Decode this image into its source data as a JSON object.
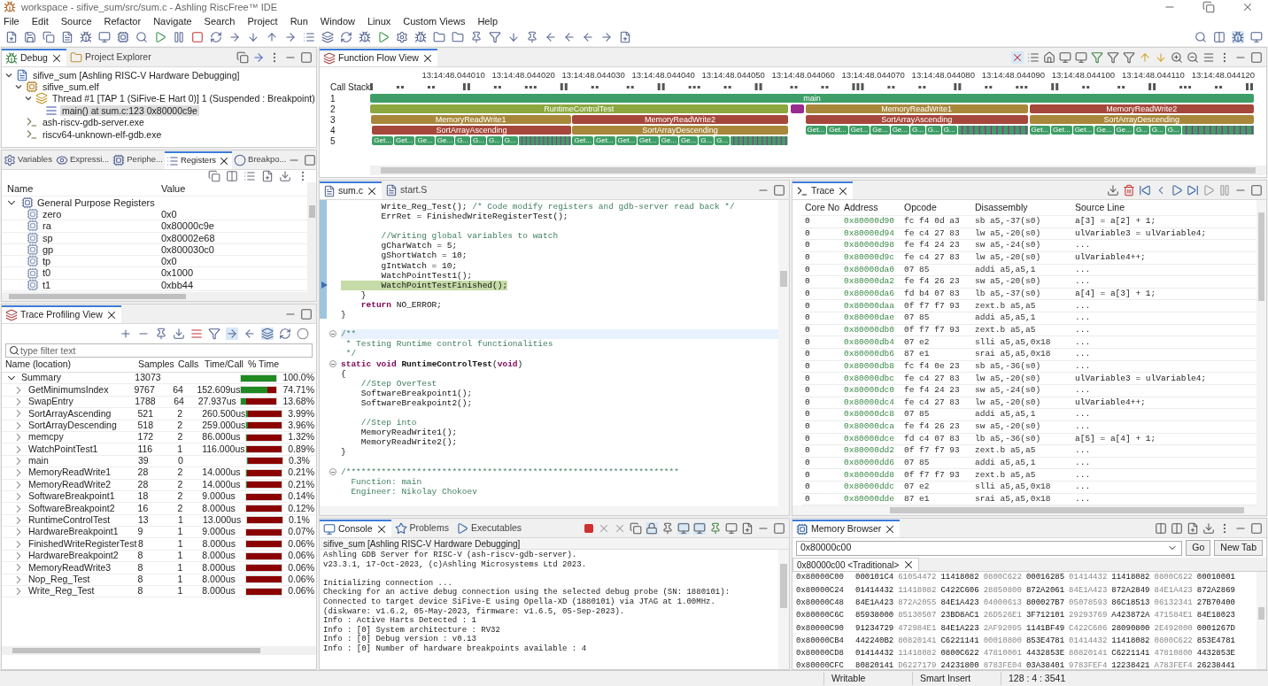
{
  "window": {
    "title": "workspace - sifive_sum/src/sum.c - Ashling RiscFree™ IDE"
  },
  "menu": [
    "File",
    "Edit",
    "Source",
    "Refactor",
    "Navigate",
    "Search",
    "Project",
    "Run",
    "Window",
    "Linux",
    "Custom Views",
    "Help"
  ],
  "debug_panel": {
    "tabs": [
      {
        "label": "Debug",
        "selected": true
      },
      {
        "label": "Project Explorer",
        "selected": false
      }
    ],
    "tree": [
      {
        "label": "sifive_sum [Ashling RISC-V Hardware Debugging]",
        "kind": "launch",
        "expanded": true,
        "selected": false,
        "children": [
          {
            "label": "sifive_sum.elf",
            "kind": "process",
            "expanded": true,
            "selected": false,
            "children": [
              {
                "label": "Thread #1 [TAP 1 (SiFive-E Hart 0)] 1 (Suspended : Breakpoint)",
                "kind": "thread",
                "expanded": true,
                "selected": false,
                "children": [
                  {
                    "label": "main() at sum.c:123 0x80000c9e",
                    "kind": "frame",
                    "selected": true
                  }
                ]
              }
            ]
          },
          {
            "label": "ash-riscv-gdb-server.exe",
            "kind": "exe",
            "selected": false
          },
          {
            "label": "riscv64-unknown-elf-gdb.exe",
            "kind": "exe",
            "selected": false
          }
        ]
      }
    ]
  },
  "registers_panel": {
    "tabs": [
      {
        "label": "Variables",
        "selected": false
      },
      {
        "label": "Expressi...",
        "selected": false
      },
      {
        "label": "Periphe...",
        "selected": false
      },
      {
        "label": "Registers",
        "selected": true
      },
      {
        "label": "Breakpo...",
        "selected": false
      }
    ],
    "columns": [
      "Name",
      "Value"
    ],
    "group": "General Purpose Registers",
    "rows": [
      {
        "name": "zero",
        "value": "0x0"
      },
      {
        "name": "ra",
        "value": "0x80000c9e"
      },
      {
        "name": "sp",
        "value": "0x80002e68"
      },
      {
        "name": "gp",
        "value": "0x800030c0"
      },
      {
        "name": "tp",
        "value": "0x0"
      },
      {
        "name": "t0",
        "value": "0x1000"
      },
      {
        "name": "t1",
        "value": "0xbb44"
      }
    ]
  },
  "profiling": {
    "title": "Trace Profiling View",
    "filter": {
      "placeholder": "type filter text"
    },
    "columns": [
      "Name (location)",
      "Samples",
      "Calls",
      "Time/Call",
      "% Time"
    ],
    "summary": {
      "name": "Summary",
      "samples": "13073",
      "level": 1,
      "percent": "100.0%"
    },
    "rows": [
      {
        "name": "GetMinimumsIndex",
        "samples": "9767",
        "calls": "64",
        "time_per_call": "152.609us",
        "level": 0.7471,
        "percent": "74.71%"
      },
      {
        "name": "SwapEntry",
        "samples": "1788",
        "calls": "64",
        "time_per_call": "27.937us",
        "level": 0.1368,
        "percent": "13.68%"
      },
      {
        "name": "SortArrayAscending",
        "samples": "521",
        "calls": "2",
        "time_per_call": "260.500us",
        "level": 0.0399,
        "percent": "3.99%"
      },
      {
        "name": "SortArrayDescending",
        "samples": "518",
        "calls": "2",
        "time_per_call": "259.000us",
        "level": 0.0396,
        "percent": "3.96%"
      },
      {
        "name": "memcpy",
        "samples": "172",
        "calls": "2",
        "time_per_call": "86.000us",
        "level": 0.0132,
        "percent": "1.32%"
      },
      {
        "name": "WatchPointTest1",
        "samples": "116",
        "calls": "1",
        "time_per_call": "116.000us",
        "level": 0.0089,
        "percent": "0.89%"
      },
      {
        "name": "main",
        "samples": "39",
        "calls": "0",
        "level": 0.003,
        "percent": "0.3%"
      },
      {
        "name": "MemoryReadWrite1",
        "samples": "28",
        "calls": "2",
        "time_per_call": "14.000us",
        "level": 0.0021,
        "percent": "0.21%"
      },
      {
        "name": "MemoryReadWrite2",
        "samples": "28",
        "calls": "2",
        "time_per_call": "14.000us",
        "level": 0.0021,
        "percent": "0.21%"
      },
      {
        "name": "SoftwareBreakpoint1",
        "samples": "18",
        "calls": "2",
        "time_per_call": "9.000us",
        "level": 0.0014,
        "percent": "0.14%"
      },
      {
        "name": "SoftwareBreakpoint2",
        "samples": "16",
        "calls": "2",
        "time_per_call": "8.000us",
        "level": 0.0012,
        "percent": "0.12%"
      },
      {
        "name": "RuntimeControlTest",
        "samples": "13",
        "calls": "1",
        "time_per_call": "13.000us",
        "level": 0.001,
        "percent": "0.1%"
      },
      {
        "name": "HardwareBreakpoint1",
        "samples": "9",
        "calls": "1",
        "time_per_call": "9.000us",
        "level": 0.0007,
        "percent": "0.07%"
      },
      {
        "name": "FinishedWriteRegisterTest",
        "samples": "8",
        "calls": "1",
        "time_per_call": "8.000us",
        "level": 0.0006,
        "percent": "0.06%"
      },
      {
        "name": "HardwareBreakpoint2",
        "samples": "8",
        "calls": "1",
        "time_per_call": "8.000us",
        "level": 0.0006,
        "percent": "0.06%"
      },
      {
        "name": "MemoryReadWrite3",
        "samples": "8",
        "calls": "1",
        "time_per_call": "8.000us",
        "level": 0.0006,
        "percent": "0.06%"
      },
      {
        "name": "Nop_Reg_Test",
        "samples": "8",
        "calls": "1",
        "time_per_call": "8.000us",
        "level": 0.0006,
        "percent": "0.06%"
      },
      {
        "name": "Write_Reg_Test",
        "samples": "8",
        "calls": "1",
        "time_per_call": "8.000us",
        "level": 0.0006,
        "percent": "0.06%"
      }
    ]
  },
  "flow_view": {
    "title": "Function Flow View",
    "ticks": [
      "13:14:48.044010",
      "13:14:48.044020",
      "13:14:48.044030",
      "13:14:48.044040",
      "13:14:48.044050",
      "13:14:48.044060",
      "13:14:48.044070",
      "13:14:48.044080",
      "13:14:48.044090",
      "13:14:48.044100",
      "13:14:48.044110",
      "13:14:48.044120"
    ],
    "callstack_label": "Call Stack",
    "rows": [
      {
        "depth": "1",
        "segments": [
          {
            "kind": "function",
            "label": "main",
            "color": "#3f9e67"
          }
        ]
      },
      {
        "depth": "2",
        "segments": [
          {
            "kind": "function",
            "label": "RuntimeControlTest",
            "color": "#8ba73d"
          },
          {
            "kind": "mark",
            "color": "#9b2a8e"
          },
          {
            "kind": "function",
            "label": "MemoryReadWrite1",
            "color": "#a8873a"
          },
          {
            "kind": "function",
            "label": "MemoryReadWrite2",
            "color": "#a5473a"
          }
        ]
      },
      {
        "depth": "3",
        "segments": [
          {
            "kind": "function",
            "label": "MemoryReadWrite1",
            "color": "#a8873a"
          },
          {
            "kind": "function",
            "label": "MemoryReadWrite2",
            "color": "#a5473a"
          },
          {
            "kind": "function",
            "label": "SortArrayAscending",
            "color": "#a5473a"
          },
          {
            "kind": "function",
            "label": "SortArrayDescending",
            "color": "#a8873a"
          }
        ]
      },
      {
        "depth": "4",
        "segments": [
          {
            "kind": "function",
            "label": "SortArrayAscending",
            "color": "#a5473a"
          },
          {
            "kind": "function",
            "label": "SortArrayDescending",
            "color": "#a8873a"
          },
          {
            "kind": "calls",
            "labels": [
              "Get...",
              "Get...",
              "Get...",
              "Ge...",
              "Ge...",
              "G...",
              "G...",
              "G..."
            ],
            "color": "#3f9e67"
          },
          {
            "kind": "calls",
            "labels": [
              "Get...",
              "Get...",
              "Get...",
              "Ge...",
              "Ge...",
              "G...",
              "G...",
              "G..."
            ],
            "color": "#3f9e67"
          }
        ]
      },
      {
        "depth": "5",
        "segments": [
          {
            "kind": "calls",
            "labels": [
              "Get...",
              "Get...",
              "Ge...",
              "Ge...",
              "G...",
              "G...",
              "G...",
              "G..."
            ],
            "color": "#3f9e67"
          },
          {
            "kind": "calls",
            "labels": [
              "Get...",
              "Get...",
              "Get...",
              "Get...",
              "Ge...",
              "Ge...",
              "G...",
              "G..."
            ],
            "color": "#3f9e67"
          }
        ]
      }
    ]
  },
  "editor": {
    "tabs": [
      {
        "label": "sum.c",
        "selected": true
      },
      {
        "label": "start.S",
        "selected": false
      }
    ],
    "blocks": [
      [
        {
          "segments": [
            {
              "kind": "code",
              "text": "        Write_Reg_Test(); "
            },
            {
              "kind": "comment",
              "text": "/* Code modify registers and gdb-server read back */"
            }
          ]
        },
        {
          "segments": [
            {
              "kind": "code",
              "text": "        ErrRet = FinishedWriteRegisterTest();"
            }
          ]
        }
      ],
      [
        {
          "segments": [
            {
              "kind": "comment",
              "text": "        //Writing global variables to watch"
            }
          ]
        },
        {
          "segments": [
            {
              "kind": "code",
              "text": "        gCharWatch = 5;"
            }
          ]
        },
        {
          "segments": [
            {
              "kind": "code",
              "text": "        gShortWatch = 10;"
            }
          ]
        },
        {
          "segments": [
            {
              "kind": "code",
              "text": "        gIntWatch = 10;"
            }
          ]
        },
        {
          "segments": [
            {
              "kind": "code",
              "text": "        WatchPointTest1();"
            }
          ]
        },
        {
          "current": true,
          "segments": [
            {
              "kind": "code",
              "text": "        WatchPointTestFinished();"
            }
          ]
        },
        {
          "segments": [
            {
              "kind": "code",
              "text": "    }"
            }
          ]
        },
        {
          "segments": [
            {
              "kind": "keyword",
              "text": "    return"
            },
            {
              "kind": "code",
              "text": " NO_ERROR;"
            }
          ]
        },
        {
          "segments": [
            {
              "kind": "code",
              "text": "}"
            }
          ]
        }
      ],
      [
        {
          "fold": true,
          "hover": true,
          "segments": [
            {
              "kind": "comment",
              "text": "/**"
            }
          ]
        },
        {
          "segments": [
            {
              "kind": "comment",
              "text": " * Testing Runtime control functionalities"
            }
          ]
        },
        {
          "segments": [
            {
              "kind": "comment",
              "text": " */"
            }
          ]
        },
        {
          "fold": true,
          "segments": [
            {
              "kind": "keyword",
              "text": "static void "
            },
            {
              "kind": "name",
              "text": "RuntimeControlTest"
            },
            {
              "kind": "code",
              "text": "("
            },
            {
              "kind": "keyword",
              "text": "void"
            },
            {
              "kind": "code",
              "text": ")"
            }
          ]
        },
        {
          "segments": [
            {
              "kind": "code",
              "text": "{"
            }
          ]
        },
        {
          "segments": [
            {
              "kind": "comment",
              "text": "    //Step OverTest"
            }
          ]
        },
        {
          "segments": [
            {
              "kind": "code",
              "text": "    SoftwareBreakpoint1();"
            }
          ]
        },
        {
          "segments": [
            {
              "kind": "code",
              "text": "    SoftwareBreakpoint2();"
            }
          ]
        }
      ],
      [
        {
          "segments": [
            {
              "kind": "comment",
              "text": "    //Step into"
            }
          ]
        },
        {
          "segments": [
            {
              "kind": "code",
              "text": "    MemoryReadWrite1();"
            }
          ]
        },
        {
          "segments": [
            {
              "kind": "code",
              "text": "    MemoryReadWrite2();"
            }
          ]
        },
        {
          "segments": [
            {
              "kind": "code",
              "text": "}"
            }
          ]
        }
      ],
      [
        {
          "fold": true,
          "segments": [
            {
              "kind": "comment",
              "text": "/******************************************************************"
            }
          ]
        },
        {
          "segments": [
            {
              "kind": "comment",
              "text": "  Function: main"
            }
          ]
        },
        {
          "segments": [
            {
              "kind": "comment",
              "text": "  Engineer: Nikolay Chokoev"
            }
          ]
        }
      ]
    ]
  },
  "trace": {
    "title": "Trace",
    "columns": [
      "Core No",
      "Address",
      "Opcode",
      "Disassembly",
      "Source Line"
    ],
    "rows": [
      [
        "0",
        "0x80000d90",
        "fc f4 0d a3",
        "sb a5,-37(s0)",
        "a[3] = a[2] + 1;"
      ],
      [
        "0",
        "0x80000d94",
        "fe c4 27 83",
        "lw a5,-20(s0)",
        "ulVariable3 = ulVariable4;"
      ],
      [
        "0",
        "0x80000d98",
        "fe f4 24 23",
        "sw a5,-24(s0)",
        "..."
      ],
      [
        "0",
        "0x80000d9c",
        "fe c4 27 83",
        "lw a5,-20(s0)",
        "ulVariable4++;"
      ],
      [
        "0",
        "0x80000da0",
        "07 85",
        "addi a5,a5,1",
        "..."
      ],
      [
        "0",
        "0x80000da2",
        "fe f4 26 23",
        "sw a5,-20(s0)",
        "..."
      ],
      [
        "0",
        "0x80000da6",
        "fd b4 07 83",
        "lb a5,-37(s0)",
        "a[4] = a[3] + 1;"
      ],
      [
        "0",
        "0x80000daa",
        "0f f7 f7 93",
        "zext.b a5,a5",
        "..."
      ],
      [
        "0",
        "0x80000dae",
        "07 85",
        "addi a5,a5,1",
        "..."
      ],
      [
        "0",
        "0x80000db0",
        "0f f7 f7 93",
        "zext.b a5,a5",
        "..."
      ],
      [
        "0",
        "0x80000db4",
        "07 e2",
        "slli a5,a5,0x18",
        "..."
      ],
      [
        "0",
        "0x80000db6",
        "87 e1",
        "srai a5,a5,0x18",
        "..."
      ],
      [
        "0",
        "0x80000db8",
        "fc f4 0e 23",
        "sb a5,-36(s0)",
        "..."
      ],
      [
        "0",
        "0x80000dbc",
        "fe c4 27 83",
        "lw a5,-20(s0)",
        "ulVariable3 = ulVariable4;"
      ],
      [
        "0",
        "0x80000dc0",
        "fe f4 24 23",
        "sw a5,-24(s0)",
        "..."
      ],
      [
        "0",
        "0x80000dc4",
        "fe c4 27 83",
        "lw a5,-20(s0)",
        "ulVariable4++;"
      ],
      [
        "0",
        "0x80000dc8",
        "07 85",
        "addi a5,a5,1",
        "..."
      ],
      [
        "0",
        "0x80000dca",
        "fe f4 26 23",
        "sw a5,-20(s0)",
        "..."
      ],
      [
        "0",
        "0x80000dce",
        "fd c4 07 83",
        "lb a5,-36(s0)",
        "a[5] = a[4] + 1;"
      ],
      [
        "0",
        "0x80000dd2",
        "0f f7 f7 93",
        "zext.b a5,a5",
        "..."
      ],
      [
        "0",
        "0x80000dd6",
        "07 85",
        "addi a5,a5,1",
        "..."
      ],
      [
        "0",
        "0x80000dd8",
        "0f f7 f7 93",
        "zext.b a5,a5",
        "..."
      ],
      [
        "0",
        "0x80000ddc",
        "07 e2",
        "slli a5,a5,0x18",
        "..."
      ],
      [
        "0",
        "0x80000dde",
        "87 e1",
        "srai a5,a5,0x18",
        "..."
      ]
    ]
  },
  "console": {
    "tabs": [
      {
        "label": "Console",
        "selected": true
      },
      {
        "label": "Problems",
        "selected": false
      },
      {
        "label": "Executables",
        "selected": false
      }
    ],
    "session": "sifive_sum [Ashling RISC-V Hardware Debugging]",
    "blocks": [
      [
        "Ashling GDB Server for RISC-V (ash-riscv-gdb-server).",
        "v23.3.1, 17-Oct-2023, (c)Ashling Microsystems Ltd 2023."
      ],
      [
        "Initializing connection ...",
        "Checking for an active debug connection using the selected debug probe (SN: 1880101):",
        "Connected to target device SiFive-E using Opella-XD (1880101) via JTAG at 1.00MHz.",
        "(diskware: v1.6.2, 05-May-2023, firmware: v1.6.5, 05-Sep-2023).",
        "Info : Active Harts Detected : 1",
        "Info : [0] System architecture : RV32",
        "Info : [0] Debug version : v0.13",
        "Info : [0] Number of hardware breakpoints available : 4"
      ]
    ]
  },
  "memory": {
    "title": "Memory Browser",
    "address": "0x80000c00",
    "go": "Go",
    "new_tab": "New Tab",
    "tab": "0x80000c00 <Traditional>",
    "rows": [
      {
        "address": "0x80000C00",
        "words": [
          "000101C4",
          "61054472",
          "11418082",
          "0800C622",
          "00016285",
          "01414432",
          "11418082",
          "0800C622",
          "00010001"
        ]
      },
      {
        "address": "0x80000C24",
        "words": [
          "01414432",
          "11418082",
          "C422C606",
          "28850800",
          "872A2061",
          "84E1A423",
          "872A2849",
          "84E1A423",
          "872A2869"
        ]
      },
      {
        "address": "0x80000C48",
        "words": [
          "84E1A423",
          "872A2055",
          "84E1A423",
          "04000613",
          "800027B7",
          "05078593",
          "86C18513",
          "06132341",
          "27B70400"
        ]
      },
      {
        "address": "0x80000C6C",
        "words": [
          "85938000",
          "85130507",
          "23BD8AC1",
          "26D526E1",
          "3F712101",
          "29293769",
          "A423872A",
          "471584E1",
          "84E18023"
        ]
      },
      {
        "address": "0x80000C90",
        "words": [
          "91234729",
          "472984E1",
          "84E1A223",
          "2AF92095",
          "1141BF49",
          "C422C606",
          "28090800",
          "2E492000",
          "0001267D"
        ]
      },
      {
        "address": "0x80000CB4",
        "words": [
          "442240B2",
          "80820141",
          "C6221141",
          "00010800",
          "853E4781",
          "01414432",
          "11418082",
          "0800C622",
          "853E4781"
        ]
      },
      {
        "address": "0x80000CD8",
        "words": [
          "01414432",
          "11418082",
          "0800C622",
          "47810001",
          "4432853E",
          "80820141",
          "C6221141",
          "47810800",
          "4432853E"
        ]
      },
      {
        "address": "0x80000CFC",
        "words": [
          "80820141",
          "D6227179",
          "24231800",
          "8783FE04",
          "03A38401",
          "9783FEF4",
          "12238421",
          "A783FEF4",
          "26238441"
        ]
      }
    ]
  },
  "status_bar": [
    "Writable",
    "Smart Insert",
    "128 : 4 : 3541"
  ]
}
